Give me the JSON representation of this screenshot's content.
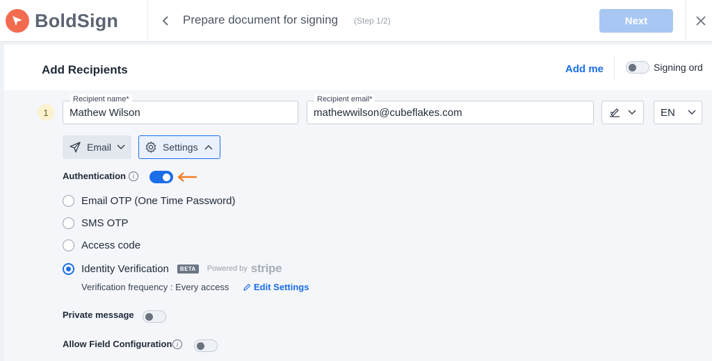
{
  "app": {
    "name": "BoldSign",
    "page_title": "Prepare document for signing",
    "step": "(Step 1/2)",
    "next_label": "Next"
  },
  "panel": {
    "title": "Add Recipients",
    "add_me": "Add me",
    "signing_order_label": "Signing ord"
  },
  "recipient": {
    "number": "1",
    "name_label": "Recipient name*",
    "name_value": "Mathew Wilson",
    "email_label": "Recipient email*",
    "email_value": "mathewwilson@cubeflakes.com",
    "language": "EN",
    "delivery_label": "Email",
    "settings_label": "Settings"
  },
  "authentication": {
    "label": "Authentication",
    "enabled": true,
    "options": [
      {
        "label": "Email OTP (One Time Password)",
        "selected": false
      },
      {
        "label": "SMS OTP",
        "selected": false
      },
      {
        "label": "Access code",
        "selected": false
      },
      {
        "label": "Identity Verification",
        "selected": true
      }
    ],
    "beta_badge": "BETA",
    "powered_by": "Powered by",
    "stripe": "stripe",
    "verification_frequency": "Verification frequency : Every access",
    "edit_settings": "Edit Settings"
  },
  "private_message": {
    "label": "Private message",
    "enabled": false
  },
  "allow_field_configuration": {
    "label": "Allow Field Configuration",
    "enabled": false
  },
  "colors": {
    "brand": "#f26b4f",
    "accent": "#1a6ee8",
    "arrow": "#f47b20"
  }
}
